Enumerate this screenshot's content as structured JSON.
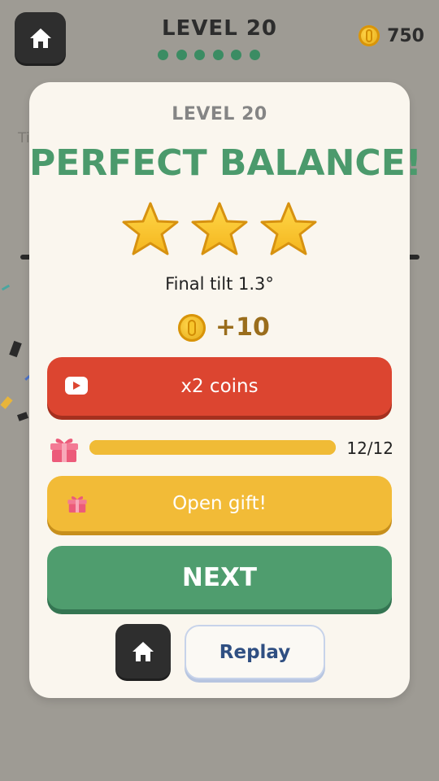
{
  "hud": {
    "level_title": "LEVEL 20",
    "coins": "750",
    "progress_dots": 6,
    "home_icon": "home-icon"
  },
  "background": {
    "partial_text": "Ti"
  },
  "modal": {
    "level_label": "LEVEL 20",
    "headline": "PERFECT BALANCE!",
    "stars_earned": 3,
    "stars_total": 3,
    "final_tilt": "Final tilt 1.3°",
    "coin_reward": "+10",
    "x2_button": {
      "label": "x2 coins",
      "icon": "video-ad-icon"
    },
    "gift_progress": {
      "text": "12/12",
      "current": 12,
      "total": 12
    },
    "open_gift_button": {
      "label": "Open gift!",
      "icon": "gift-icon"
    },
    "next_button": {
      "label": "NEXT"
    },
    "replay_button": {
      "label": "Replay"
    }
  },
  "colors": {
    "headline": "#4b9a6c",
    "x2": "#dc4530",
    "gift": "#f2bb37",
    "next": "#4f9d6e",
    "home": "#2e2e2e"
  }
}
